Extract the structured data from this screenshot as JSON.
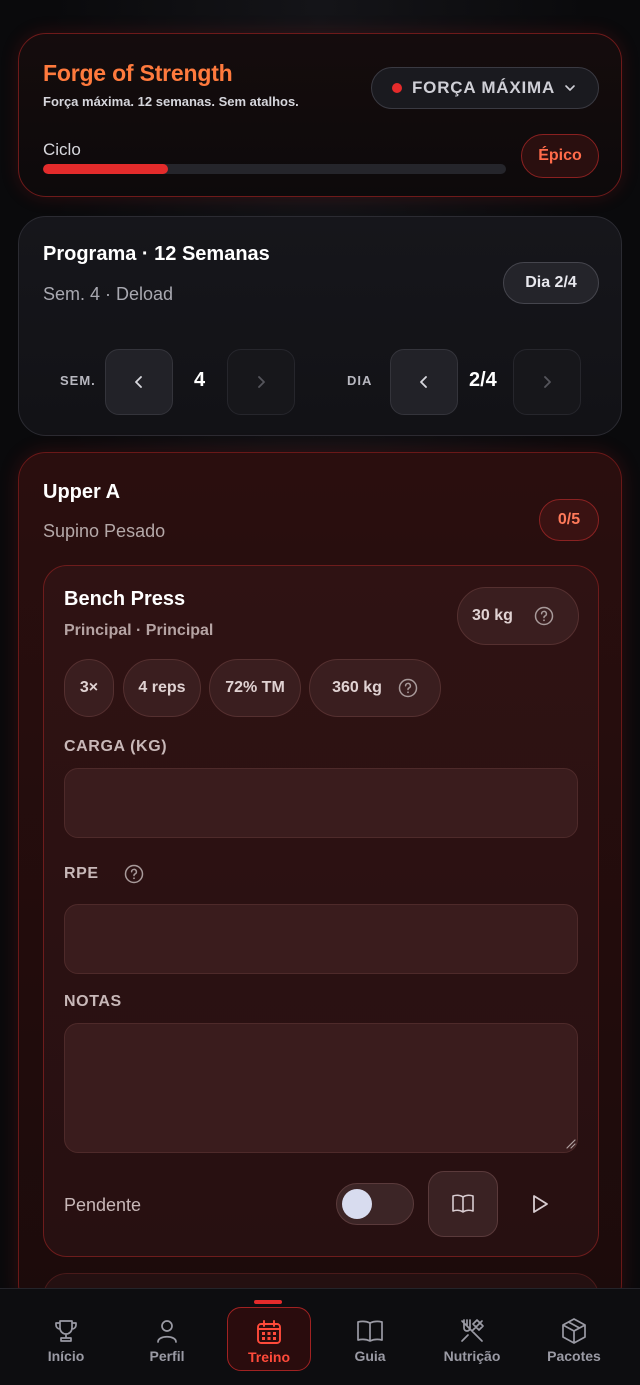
{
  "hero": {
    "title": "Forge of Strength",
    "subtitle": "Força máxima. 12 semanas. Sem atalhos.",
    "mode_label": "FORÇA MÁXIMA",
    "cycle_label": "Ciclo",
    "cycle_progress": 0.27,
    "tier_badge": "Épico"
  },
  "program": {
    "title": "Programa · 12 Semanas",
    "subtitle": "Sem. 4 · Deload",
    "day_badge": "Dia 2/4",
    "week_label": "SEM.",
    "week_value": "4",
    "day_label": "DIA",
    "day_value": "2/4"
  },
  "workout": {
    "title": "Upper A",
    "subtitle": "Supino Pesado",
    "progress": "0/5",
    "exercise": {
      "name": "Bench Press",
      "category": "Principal · Principal",
      "weight": "30 kg",
      "chips": [
        "3×",
        "4 reps",
        "72% TM",
        "360 kg"
      ],
      "load_label": "CARGA (KG)",
      "load_value": "",
      "rpe_label": "RPE",
      "rpe_value": "",
      "notes_label": "NOTAS",
      "notes_value": "",
      "status_label": "Pendente",
      "done": false
    }
  },
  "nav": {
    "items": [
      {
        "label": "Início",
        "icon": "trophy-icon"
      },
      {
        "label": "Perfil",
        "icon": "user-icon"
      },
      {
        "label": "Treino",
        "icon": "calendar-icon",
        "active": true
      },
      {
        "label": "Guia",
        "icon": "book-icon"
      },
      {
        "label": "Nutrição",
        "icon": "utensils-icon"
      },
      {
        "label": "Pacotes",
        "icon": "package-icon"
      }
    ]
  },
  "colors": {
    "accent": "#e52b2b",
    "title_orange": "#ff7a3d",
    "badge_text": "#ff6b4a"
  }
}
